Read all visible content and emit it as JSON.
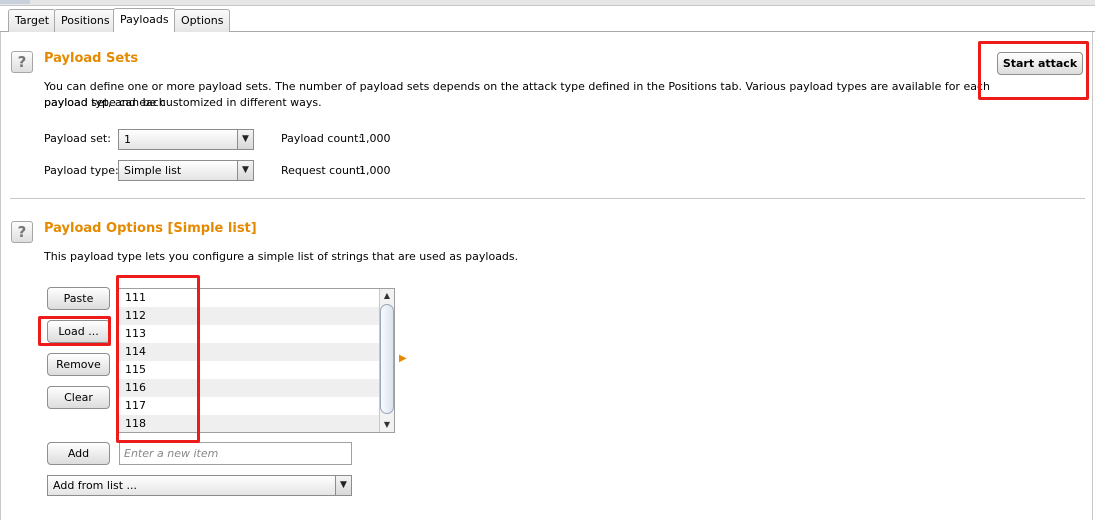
{
  "tabs": [
    {
      "label": "Target",
      "active": false
    },
    {
      "label": "Positions",
      "active": false
    },
    {
      "label": "Payloads",
      "active": true
    },
    {
      "label": "Options",
      "active": false
    }
  ],
  "payload_sets": {
    "help_glyph": "?",
    "title": "Payload Sets",
    "description_line1": "You can define one or more payload sets. The number of payload sets depends on the attack type defined in the Positions tab. Various payload types are available for each payload set, and each",
    "description_line2": "payload type can be customized in different ways.",
    "start_attack_label": "Start attack",
    "payload_set_label": "Payload set:",
    "payload_set_value": "1",
    "payload_type_label": "Payload type:",
    "payload_type_value": "Simple list",
    "payload_count_label": "Payload count:",
    "payload_count_value": "1,000",
    "request_count_label": "Request count:",
    "request_count_value": "1,000"
  },
  "payload_options": {
    "help_glyph": "?",
    "title": "Payload Options [Simple list]",
    "description": "This payload type lets you configure a simple list of strings that are used as payloads.",
    "buttons": {
      "paste": "Paste",
      "load": "Load ...",
      "remove": "Remove",
      "clear": "Clear",
      "add": "Add"
    },
    "list_items": [
      "111",
      "112",
      "113",
      "114",
      "115",
      "116",
      "117",
      "118"
    ],
    "new_item_placeholder": "Enter a new item",
    "add_from_list_value": "Add from list ..."
  },
  "colors": {
    "section_title": "#e58a00",
    "highlight": "#ee1b1b"
  }
}
